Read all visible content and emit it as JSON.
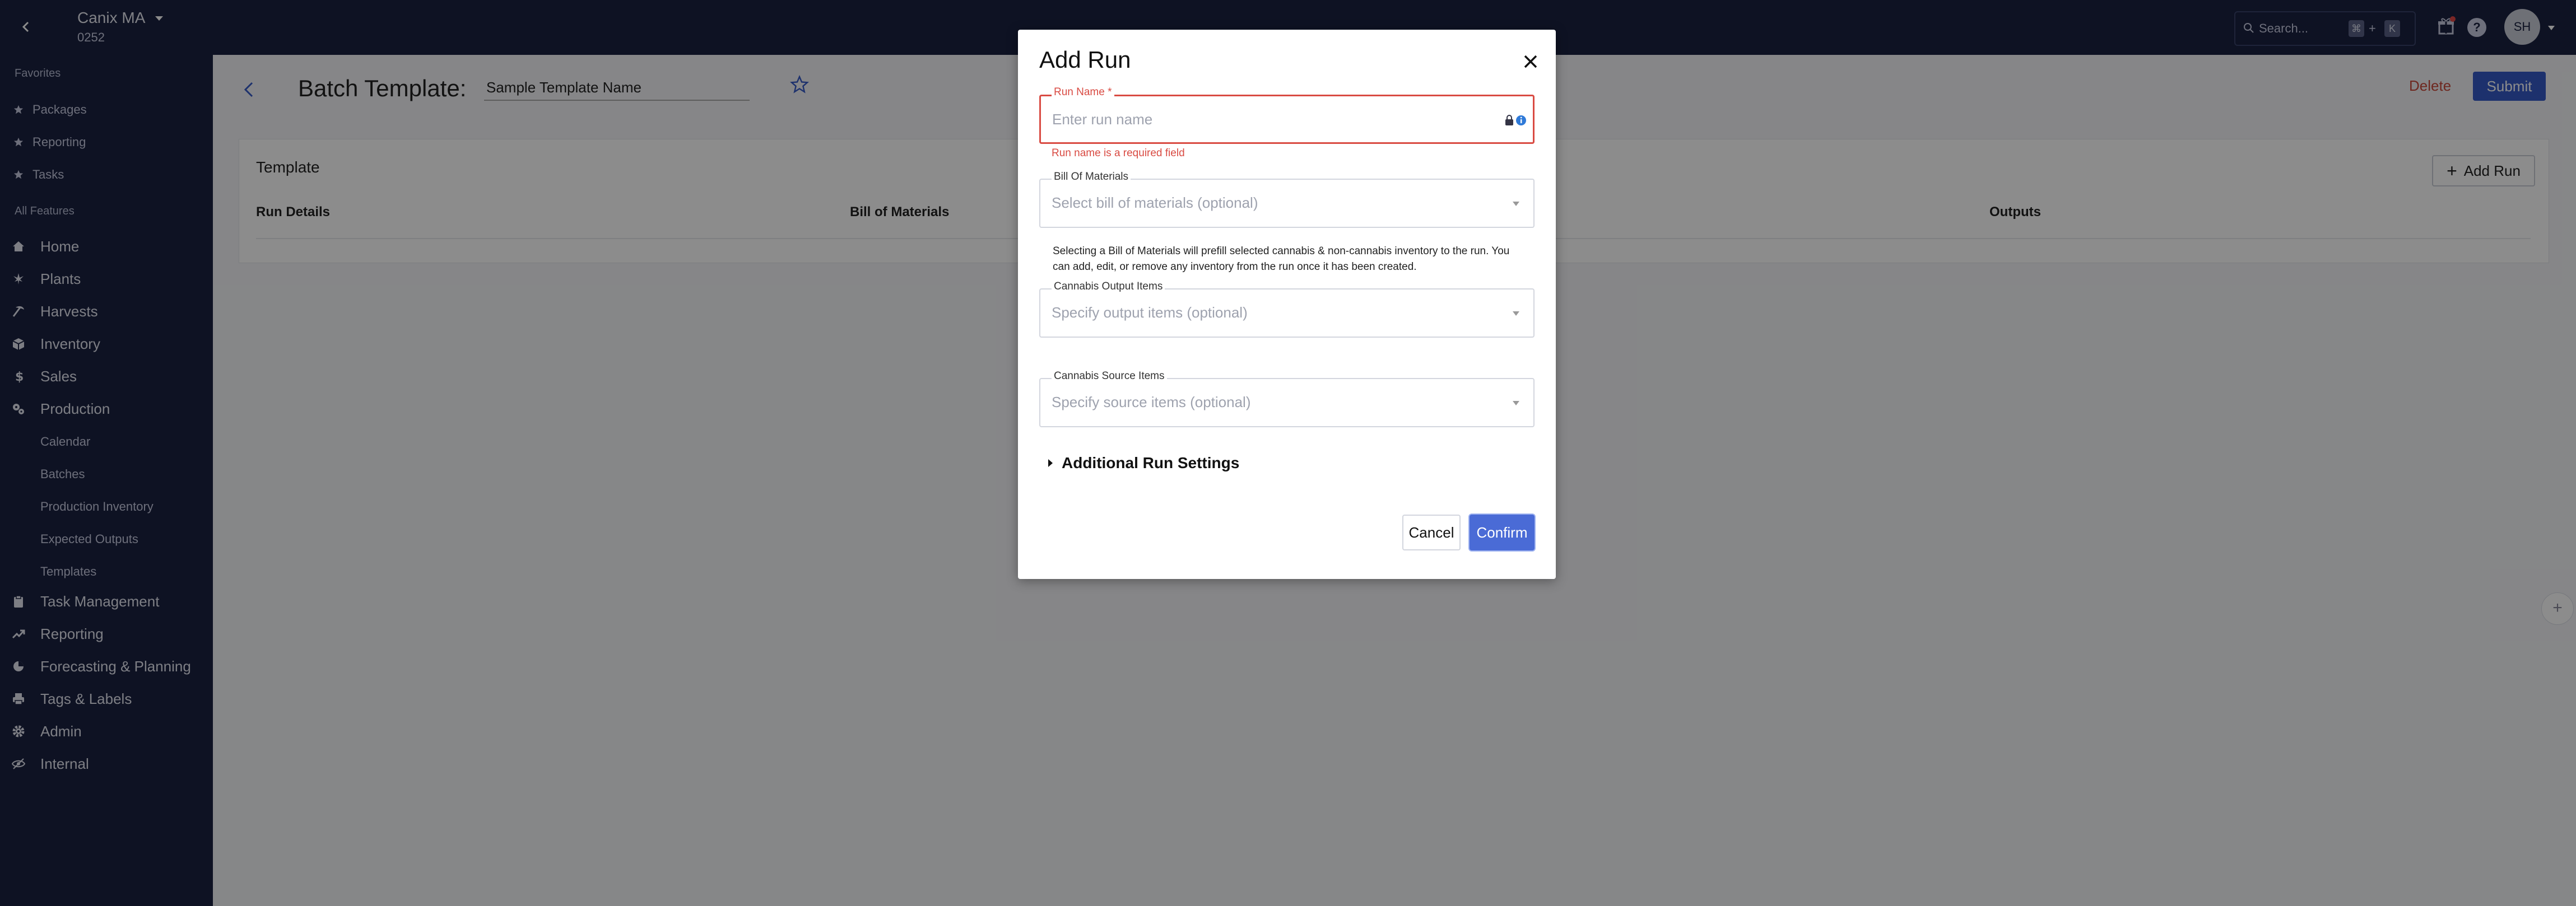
{
  "topbar": {
    "org_name": "Canix MA",
    "org_id": "0252",
    "search_placeholder": "Search...",
    "search_kbd_1": "⌘",
    "search_kbd_plus": "+",
    "search_kbd_2": "K",
    "avatar_initials": "SH"
  },
  "sidebar": {
    "favorites_header": "Favorites",
    "favorites": [
      "Packages",
      "Reporting",
      "Tasks"
    ],
    "all_features_header": "All Features",
    "nav": {
      "home": "Home",
      "plants": "Plants",
      "harvests": "Harvests",
      "inventory": "Inventory",
      "sales": "Sales",
      "production": "Production",
      "task_management": "Task Management",
      "reporting": "Reporting",
      "forecasting": "Forecasting & Planning",
      "tags": "Tags & Labels",
      "admin": "Admin",
      "internal": "Internal"
    },
    "production_sub": [
      "Calendar",
      "Batches",
      "Production Inventory",
      "Expected Outputs",
      "Templates"
    ]
  },
  "page": {
    "title": "Batch Template:",
    "template_name_value": "Sample Template Name",
    "delete_label": "Delete",
    "submit_label": "Submit",
    "card_title": "Template",
    "add_run_label": "Add Run",
    "columns": [
      "Run Details",
      "Bill of Materials",
      "Outputs"
    ],
    "fab_label": "+"
  },
  "modal": {
    "title": "Add Run",
    "run_name_label": "Run Name *",
    "run_name_placeholder": "Enter run name",
    "run_name_error": "Run name is a required field",
    "bom_label": "Bill Of Materials",
    "bom_placeholder": "Select bill of materials (optional)",
    "bom_help": "Selecting a Bill of Materials will prefill selected cannabis & non-cannabis inventory to the run. You can add, edit, or remove any inventory from the run once it has been created.",
    "output_label": "Cannabis Output Items",
    "output_placeholder": "Specify output items (optional)",
    "source_label": "Cannabis Source Items",
    "source_placeholder": "Specify source items (optional)",
    "advanced_label": "Additional Run Settings",
    "cancel_label": "Cancel",
    "confirm_label": "Confirm"
  },
  "colors": {
    "nav_bg": "#1a2140",
    "primary": "#4a6bd6",
    "error": "#d94b43",
    "delete": "#c9493b"
  }
}
